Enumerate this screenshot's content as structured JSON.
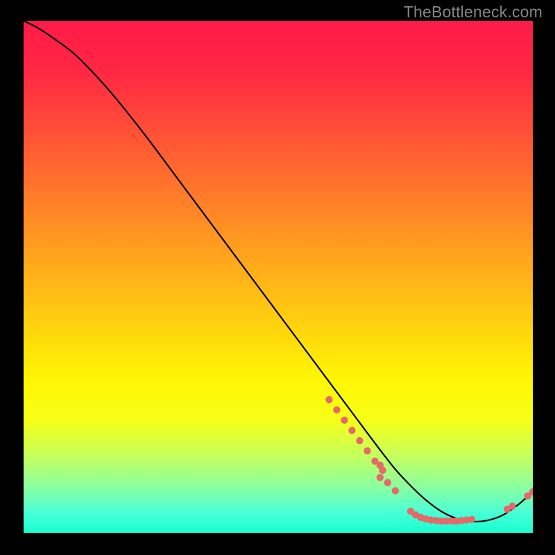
{
  "watermark": "TheBottleneck.com",
  "chart_data": {
    "type": "line",
    "title": "",
    "xlabel": "",
    "ylabel": "",
    "xlim": [
      0,
      100
    ],
    "ylim": [
      0,
      100
    ],
    "grid": false,
    "legend": false,
    "background_gradient": {
      "stops": [
        {
          "offset": 0.0,
          "color": "#ff1a49"
        },
        {
          "offset": 0.1,
          "color": "#ff2843"
        },
        {
          "offset": 0.25,
          "color": "#ff5b33"
        },
        {
          "offset": 0.4,
          "color": "#ff8f23"
        },
        {
          "offset": 0.55,
          "color": "#ffc313"
        },
        {
          "offset": 0.7,
          "color": "#fff603"
        },
        {
          "offset": 0.78,
          "color": "#f7ff17"
        },
        {
          "offset": 0.85,
          "color": "#c4ff5d"
        },
        {
          "offset": 0.91,
          "color": "#8bffa0"
        },
        {
          "offset": 0.96,
          "color": "#4affd6"
        },
        {
          "offset": 1.0,
          "color": "#17ffd1"
        }
      ]
    },
    "series": [
      {
        "name": "curve",
        "color": "#000000",
        "x": [
          0,
          3,
          6,
          10,
          14,
          18,
          24,
          30,
          36,
          42,
          48,
          54,
          60,
          66,
          70,
          73,
          76,
          79,
          82,
          85,
          88,
          91,
          94,
          97,
          100
        ],
        "y": [
          100,
          98.5,
          96.5,
          93.5,
          89.5,
          85.0,
          77.5,
          69.5,
          61.5,
          53.5,
          45.5,
          37.5,
          29.5,
          21.5,
          16.2,
          12.4,
          9.2,
          6.4,
          4.2,
          2.8,
          2.2,
          2.4,
          3.4,
          5.4,
          8.0
        ]
      }
    ],
    "scatter": [
      {
        "name": "dots",
        "color": "#e46a6a",
        "points": [
          {
            "x": 60.0,
            "y": 26.0
          },
          {
            "x": 61.5,
            "y": 24.0
          },
          {
            "x": 63.0,
            "y": 22.0
          },
          {
            "x": 64.5,
            "y": 20.0
          },
          {
            "x": 66.0,
            "y": 18.0
          },
          {
            "x": 67.5,
            "y": 16.0
          },
          {
            "x": 69.0,
            "y": 14.0
          },
          {
            "x": 70.5,
            "y": 12.2
          },
          {
            "x": 70.0,
            "y": 13.2
          },
          {
            "x": 70.0,
            "y": 10.8
          },
          {
            "x": 71.5,
            "y": 9.8
          },
          {
            "x": 73.0,
            "y": 8.2
          },
          {
            "x": 76.0,
            "y": 4.2
          },
          {
            "x": 77.0,
            "y": 3.5
          },
          {
            "x": 78.0,
            "y": 3.0
          },
          {
            "x": 79.0,
            "y": 2.7
          },
          {
            "x": 80.0,
            "y": 2.5
          },
          {
            "x": 81.0,
            "y": 2.4
          },
          {
            "x": 82.0,
            "y": 2.3
          },
          {
            "x": 83.0,
            "y": 2.3
          },
          {
            "x": 84.0,
            "y": 2.3
          },
          {
            "x": 85.0,
            "y": 2.3
          },
          {
            "x": 86.0,
            "y": 2.4
          },
          {
            "x": 87.0,
            "y": 2.5
          },
          {
            "x": 88.0,
            "y": 2.6
          },
          {
            "x": 95.0,
            "y": 4.6
          },
          {
            "x": 96.0,
            "y": 5.2
          },
          {
            "x": 99.0,
            "y": 7.2
          },
          {
            "x": 100.0,
            "y": 8.0
          }
        ]
      }
    ]
  }
}
